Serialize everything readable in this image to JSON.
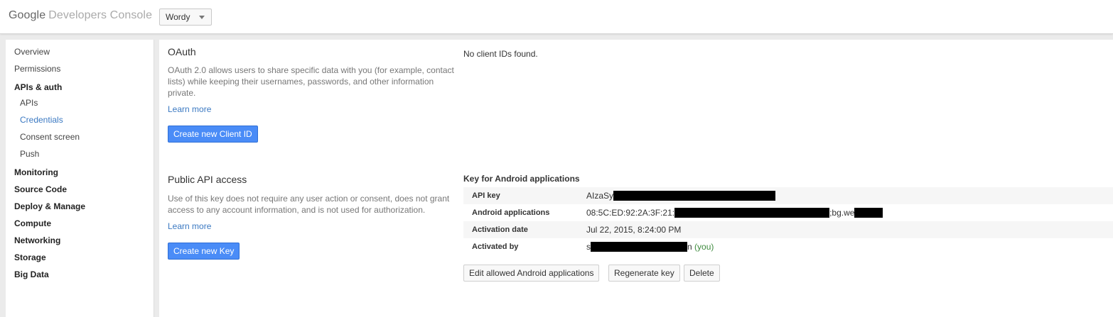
{
  "header": {
    "logo_google": "Google",
    "logo_product": "Developers Console",
    "project": "Wordy"
  },
  "sidebar": {
    "items": [
      {
        "label": "Overview"
      },
      {
        "label": "Permissions"
      },
      {
        "label": "APIs & auth"
      },
      {
        "label": "APIs"
      },
      {
        "label": "Credentials"
      },
      {
        "label": "Consent screen"
      },
      {
        "label": "Push"
      },
      {
        "label": "Monitoring"
      },
      {
        "label": "Source Code"
      },
      {
        "label": "Deploy & Manage"
      },
      {
        "label": "Compute"
      },
      {
        "label": "Networking"
      },
      {
        "label": "Storage"
      },
      {
        "label": "Big Data"
      }
    ]
  },
  "oauth": {
    "title": "OAuth",
    "description": "OAuth 2.0 allows users to share specific data with you (for example, contact lists) while keeping their usernames, passwords, and other information private.",
    "learn_more": "Learn more",
    "button": "Create new Client ID",
    "empty_text": "No client IDs found."
  },
  "public_api": {
    "title": "Public API access",
    "description": "Use of this key does not require any user action or consent, does not grant access to any account information, and is not used for authorization.",
    "learn_more": "Learn more",
    "button": "Create new Key"
  },
  "key": {
    "title": "Key for Android applications",
    "rows": [
      {
        "label": "API key",
        "value": "AIzaSy"
      },
      {
        "label": "Android applications",
        "value": "08:5C:ED:92:2A:3F:21:",
        "value_mid": ";bg.we"
      },
      {
        "label": "Activation date",
        "value": "Jul 22, 2015, 8:24:00 PM"
      },
      {
        "label": "Activated by",
        "value": "s",
        "value_mid": "n",
        "value_you": "(you)"
      }
    ],
    "buttons": {
      "edit": "Edit allowed Android applications",
      "regenerate": "Regenerate key",
      "delete": "Delete"
    }
  }
}
